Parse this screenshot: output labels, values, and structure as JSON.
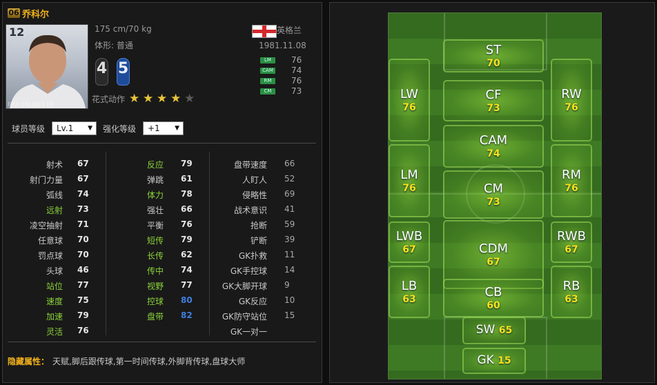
{
  "player": {
    "season_badge": "06",
    "name": "乔科尔",
    "jersey_number": "12",
    "photo_watermark": "FIFA ONLINE3 KR",
    "height_weight": "175 cm/70 kg",
    "body_type": "体形: 普通",
    "nationality": "英格兰",
    "birth_date": "1981.11.08",
    "weak_foot_left": "4",
    "weak_foot_right": "5",
    "skill_moves_label": "花式动作",
    "skill_moves_stars": 4,
    "skill_moves_max": 5
  },
  "position_ratings": [
    {
      "pos": "LM",
      "value": "76"
    },
    {
      "pos": "CAM",
      "value": "74"
    },
    {
      "pos": "RM",
      "value": "76"
    },
    {
      "pos": "CM",
      "value": "73"
    }
  ],
  "controls": {
    "player_level_label": "球员等级",
    "player_level_value": "Lv.1",
    "enhance_level_label": "强化等级",
    "enhance_level_value": "+1"
  },
  "stats_col1": [
    {
      "label": "射术",
      "value": "67",
      "highlight": false
    },
    {
      "label": "射门力量",
      "value": "67",
      "highlight": false
    },
    {
      "label": "弧线",
      "value": "74",
      "highlight": false
    },
    {
      "label": "远射",
      "value": "73",
      "highlight": true
    },
    {
      "label": "凌空抽射",
      "value": "71",
      "highlight": false
    },
    {
      "label": "任意球",
      "value": "70",
      "highlight": false
    },
    {
      "label": "罚点球",
      "value": "70",
      "highlight": false
    },
    {
      "label": "头球",
      "value": "46",
      "highlight": false
    },
    {
      "label": "站位",
      "value": "77",
      "highlight": true
    },
    {
      "label": "速度",
      "value": "75",
      "highlight": true
    },
    {
      "label": "加速",
      "value": "79",
      "highlight": true
    },
    {
      "label": "灵活",
      "value": "76",
      "highlight": true
    }
  ],
  "stats_col2": [
    {
      "label": "反应",
      "value": "79",
      "highlight": true
    },
    {
      "label": "弹跳",
      "value": "61",
      "highlight": false
    },
    {
      "label": "体力",
      "value": "78",
      "highlight": true
    },
    {
      "label": "强壮",
      "value": "66",
      "highlight": false
    },
    {
      "label": "平衡",
      "value": "76",
      "highlight": false
    },
    {
      "label": "短传",
      "value": "79",
      "highlight": true
    },
    {
      "label": "长传",
      "value": "62",
      "highlight": true
    },
    {
      "label": "传中",
      "value": "74",
      "highlight": true
    },
    {
      "label": "视野",
      "value": "77",
      "highlight": true
    },
    {
      "label": "控球",
      "value": "80",
      "highlight": true,
      "blue": true
    },
    {
      "label": "盘带",
      "value": "82",
      "highlight": true,
      "blue": true
    }
  ],
  "stats_col3": [
    {
      "label": "盘带速度",
      "value": "66"
    },
    {
      "label": "人盯人",
      "value": "52"
    },
    {
      "label": "侵略性",
      "value": "69"
    },
    {
      "label": "战术意识",
      "value": "41"
    },
    {
      "label": "抢断",
      "value": "59"
    },
    {
      "label": "铲断",
      "value": "39"
    },
    {
      "label": "GK扑救",
      "value": "11"
    },
    {
      "label": "GK手控球",
      "value": "14"
    },
    {
      "label": "GK大脚开球",
      "value": "9"
    },
    {
      "label": "GK反应",
      "value": "10"
    },
    {
      "label": "GK防守站位",
      "value": "15"
    },
    {
      "label": "GK一对一",
      "value": ""
    }
  ],
  "hidden_traits": {
    "label": "隐藏属性：",
    "value": "天赋,脚后跟传球,第一时间传球,外脚背传球,盘球大师"
  },
  "pitch_positions": [
    {
      "pos": "ST",
      "value": "70"
    },
    {
      "pos": "LW",
      "value": "76"
    },
    {
      "pos": "CF",
      "value": "73"
    },
    {
      "pos": "RW",
      "value": "76"
    },
    {
      "pos": "CAM",
      "value": "74"
    },
    {
      "pos": "LM",
      "value": "76"
    },
    {
      "pos": "CM",
      "value": "73"
    },
    {
      "pos": "RM",
      "value": "76"
    },
    {
      "pos": "LWB",
      "value": "67"
    },
    {
      "pos": "CDM",
      "value": "67"
    },
    {
      "pos": "RWB",
      "value": "67"
    },
    {
      "pos": "LB",
      "value": "63"
    },
    {
      "pos": "CB",
      "value": "60"
    },
    {
      "pos": "RB",
      "value": "63"
    },
    {
      "pos": "SW",
      "value": "65"
    },
    {
      "pos": "GK",
      "value": "15"
    }
  ],
  "colors": {
    "name": "#f2b21b",
    "highlight_label": "#8bd23a",
    "blue_value": "#3f7fe0",
    "pitch_value": "#f5e31a",
    "hidden_label": "#f2b21b"
  }
}
